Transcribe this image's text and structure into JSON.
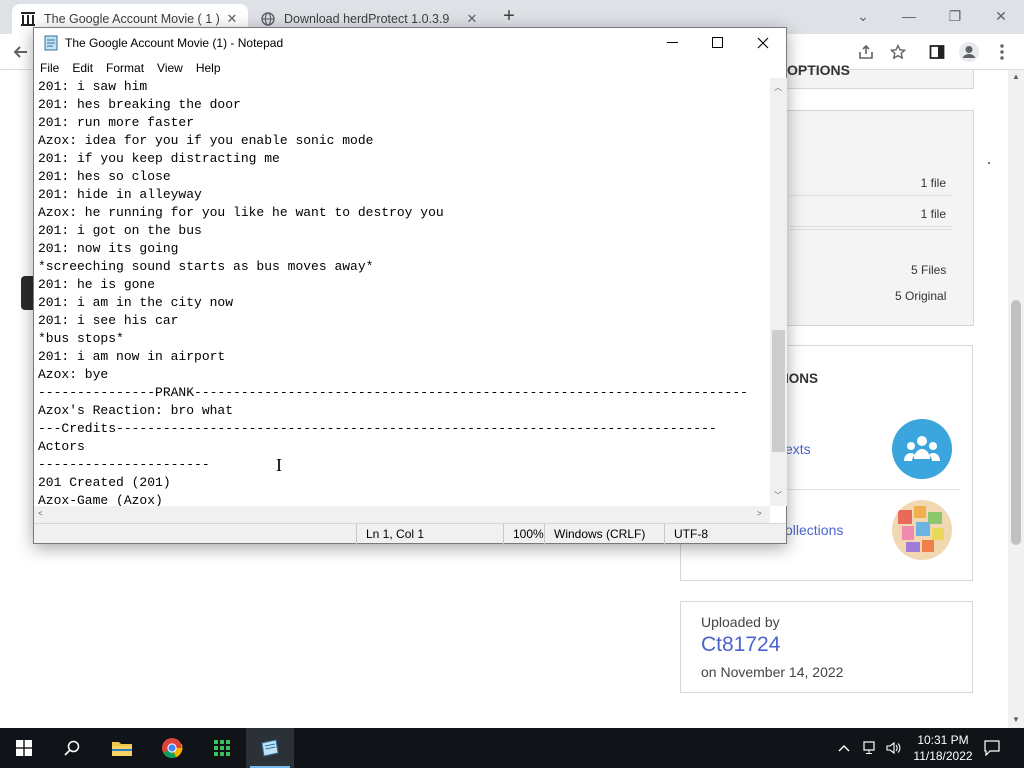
{
  "browser": {
    "tabs": [
      {
        "title": "The Google Account Movie ( 1 ) :",
        "active": true,
        "icon": "archive-icon"
      },
      {
        "title": "Download herdProtect 1.0.3.9",
        "active": false,
        "icon": "globe-icon"
      }
    ],
    "new_tab": "+",
    "window_controls": {
      "chevron": "⌄",
      "minimize": "—",
      "restore": "❐",
      "close": "✕"
    }
  },
  "page": {
    "options_title": "OPTIONS",
    "options_rows": [
      {
        "value": "1 file"
      },
      {
        "value": "1 file"
      }
    ],
    "files_value": "5 Files",
    "original_value": "5 Original",
    "collections_title": "IONS",
    "links": [
      {
        "text": "exts"
      },
      {
        "text": "ollections"
      }
    ],
    "uploaded_by_label": "Uploaded by",
    "uploader": "Ct81724",
    "upload_date": "on November 14, 2022"
  },
  "notepad": {
    "title": "The Google Account Movie (1) - Notepad",
    "menu": [
      "File",
      "Edit",
      "Format",
      "View",
      "Help"
    ],
    "lines": [
      "201: i saw him",
      "201: hes breaking the door",
      "201: run more faster",
      "Azox: idea for you if you enable sonic mode",
      "201: if you keep distracting me",
      "201: hes so close",
      "201: hide in alleyway",
      "Azox: he running for you like he want to destroy you",
      "201: i got on the bus",
      "201: now its going",
      "*screeching sound starts as bus moves away*",
      "201: he is gone",
      "201: i am in the city now",
      "201: i see his car",
      "*bus stops*",
      "201: i am now in airport",
      "Azox: bye",
      "---------------PRANK-----------------------------------------------------------------------",
      "Azox's Reaction: bro what",
      "---Credits-----------------------------------------------------------------------------",
      "Actors",
      "----------------------",
      "201 Created (201)",
      "Azox-Game (Azox)"
    ],
    "status": {
      "position": "Ln 1, Col 1",
      "zoom": "100%",
      "line_endings": "Windows (CRLF)",
      "encoding": "UTF-8"
    }
  },
  "taskbar": {
    "apps": [
      "start-icon",
      "search-icon",
      "file-explorer-icon",
      "chrome-icon",
      "app-grid-icon",
      "notepad-icon"
    ],
    "time": "10:31 PM",
    "date": "11/18/2022"
  },
  "colors": {
    "link": "#4b64ce",
    "taskbar": "#101418",
    "tabstrip": "#dee1e6",
    "circle_blue": "#3aa6dd"
  }
}
